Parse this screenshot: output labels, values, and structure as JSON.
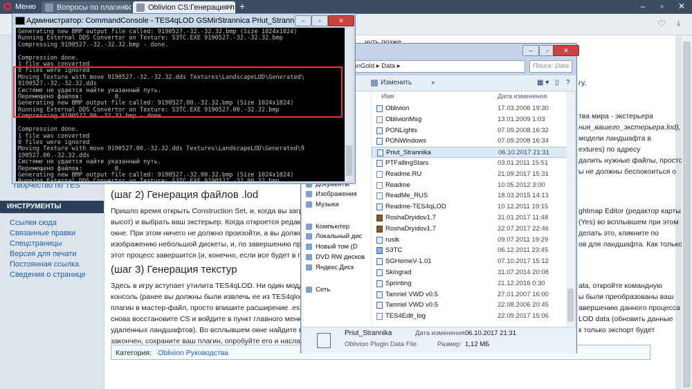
{
  "browser": {
    "menu_label": "Меню",
    "tabs": [
      {
        "label": "Вопросы по плагиностр"
      },
      {
        "label": "Oblivion CS:Генерация л"
      }
    ],
    "new_tab": "+"
  },
  "wiki": {
    "top_text": "чуть позже.",
    "right_fragments": [
      "гу.",
      "тва мира - экстерьера",
      "ния_вашего_экстерьера.lod),",
      "модели ландшафта в",
      "extures) по адресу",
      "далить нужные файлы, просто",
      "ы не должны беспокоиться о"
    ],
    "tes_link": "Творчество по TES",
    "sidebar_heading": "ИНСТРУМЕНТЫ",
    "sidebar_links": [
      "Ссылки сюда",
      "Связанные правки",
      "Спецстраницы",
      "Версия для печати",
      "Постоянная ссылка",
      "Сведения о странице"
    ],
    "step2_title": "(шаг 2) Генерация файлов .lod",
    "step2_lines": [
      "Пришло время открыть Construction Set, и, когда вы загрузите",
      "высот) и выбрать ваш экстерьер. Когда откроется редактор выс",
      "окне. При этом ничего не должно произойти, а вы должны сохр",
      "изображению небольшой дискеты, и, по завершению процесса",
      "этот процесс завершится (и, конечно, если все будет в порядке"
    ],
    "step2_right": [
      "ghtmap Editor (редактор карты",
      "(Yes) во всплывшем при этом",
      "делать это, кликните по",
      "ов для ландшафта. Как только"
    ],
    "step3_title": "(шаг 3) Генерация текстур",
    "step3_lines": [
      "Здесь в игру вступает утилита TES4qLOD. Ни один моддер по",
      "консоль (ранее вы должны были извлечь ее из TES4qlod), и к",
      "плагин в мастер-файл, просто впишите расширение .esm вмес",
      "снова восстановите CS и войдите в пункт главного меню World",
      "удаленных ландшафтов). Во всплывшем окне найдите в списк",
      "закончен, сохраните ваш плагин, опробуйте его и наслаждайт"
    ],
    "step3_right": [
      "ata, откройте командную",
      "ы были преобразованы ваш",
      "авершению данного процесса",
      "LOD data (обновить данные",
      "к только экспорт будет"
    ],
    "category_label": "Категория:",
    "category_link": "Oblivion Руководства"
  },
  "console": {
    "title": "Администратор: CommandConsole - TES4qLOD  GSMirStrannica Priut_Strannika.esp",
    "lines": [
      "Generating new BMP output file called: 9190527.-32.-32.32.bmp (Size 1024x1024)",
      "Running External DDS Convertor on Texture: S3TC.EXE 9190527.-32.-32.32.bmp",
      "Compressing 9190527.-32.-32.32.bmp - done.",
      "",
      "Compression done.",
      "1 file was converted",
      "0 files were ignored",
      "Moving Texture with move 9190527.-32.-32.32.dds Textures\\LandscapeLOD\\Generated\\",
      "9190527.-32.-32.32.dds",
      "Системе не удается найти указанный путь.",
      "Перемещено файлов:         0.",
      "Generating new BMP output file called: 9190527.00.-32.32.bmp (Size 1024x1024)",
      "Running External DDS Convertor on Texture: S3TC.EXE 9190527.00.-32.32.bmp",
      "Compressing 9190527.00.-32.32.bmp - done.",
      "",
      "Compression done.",
      "1 file was converted",
      "0 files were ignored",
      "Moving Texture with move 9190527.00.-32.32.dds Textures\\LandscapeLOD\\Generated\\9",
      "190527.00.-32.32.dds",
      "Системе не удается найти указанный путь.",
      "Перемещено файлов:         0.",
      "Generating new BMP output file called: 9190527.-32.00.32.bmp (Size 1024x1024)",
      "Running External DDS Convertor on Texture: S3TC.EXE 9190527.-32.00.32.bmp"
    ]
  },
  "explorer": {
    "path": "Games  ▸  OblivionGold  ▸  Data  ▸",
    "search_placeholder": "Поиск: Data",
    "toolbar_change": "Изменить",
    "toolbar_more": "»",
    "col_name": "Имя",
    "col_date": "Дата изменения",
    "nav": [
      {
        "label": "е мес"
      },
      {
        "label": "узки"
      },
      {
        "label": "стол"
      },
      {
        "label": "ioteka"
      },
      {
        "label": "Документы"
      },
      {
        "label": "Изображения"
      },
      {
        "label": "Музыка"
      },
      {
        "label": "Компьютер"
      },
      {
        "label": "Локальный дис"
      },
      {
        "label": "Новый том (D"
      },
      {
        "label": "DVD RW дисков"
      },
      {
        "label": "Яндекс.Диск"
      },
      {
        "label": "Сеть"
      }
    ],
    "files": [
      {
        "name": "Oblivion",
        "date": "17.03.2006 19:30",
        "kind": "esp"
      },
      {
        "name": "OblivionMsg",
        "date": "13.01.2009 1:03",
        "kind": "doc"
      },
      {
        "name": "PONLights",
        "date": "07.09.2008 16:32",
        "kind": "esp"
      },
      {
        "name": "PONWindows",
        "date": "07.09.2008 16:34",
        "kind": "esp"
      },
      {
        "name": "Priut_Strannika",
        "date": "06.10.2017 21:31",
        "kind": "esp"
      },
      {
        "name": "PTFallingStars",
        "date": "03.01.2011 15:51",
        "kind": "esp"
      },
      {
        "name": "Readme.RU",
        "date": "21.09.2017 15:31",
        "kind": "doc"
      },
      {
        "name": "Readme",
        "date": "10.05.2012 3:00",
        "kind": "doc"
      },
      {
        "name": "ReadMe_RUS",
        "date": "18.03.2015 14:13",
        "kind": "doc"
      },
      {
        "name": "Readme-TES4qLOD",
        "date": "10.12.2011 19:15",
        "kind": "esp"
      },
      {
        "name": "RoshaDryidov1.7",
        "date": "31.01.2017 11:48",
        "kind": "img"
      },
      {
        "name": "RoshaDryidov1.7",
        "date": "22.07.2017 22:46",
        "kind": "img"
      },
      {
        "name": "rusik",
        "date": "09.07.2011 19:29",
        "kind": "esp"
      },
      {
        "name": "S3TC",
        "date": "06.12.2011 23:45",
        "kind": "exe"
      },
      {
        "name": "SGHomeV-1.01",
        "date": "07.10.2017 15:12",
        "kind": "esp"
      },
      {
        "name": "Skingrad",
        "date": "31.07.2014 20:08",
        "kind": "esp"
      },
      {
        "name": "Sprinting",
        "date": "21.12.2016 0:30",
        "kind": "esp"
      },
      {
        "name": "Tamriel VWD v0.5",
        "date": "27.01.2007 16:00",
        "kind": "esp"
      },
      {
        "name": "Tamriel VWD v0.5",
        "date": "22.08.2006 20:45",
        "kind": "esp"
      },
      {
        "name": "TES4Edit_log",
        "date": "22.09.2017 15:06",
        "kind": "doc"
      }
    ],
    "details": {
      "name": "Priut_Strannika",
      "type": "Oblivion Plugin Data File",
      "date_label": "Дата изменения:",
      "date_value": "06.10.2017 21:31",
      "size_label": "Размер:",
      "size_value": "1,12 МБ"
    }
  }
}
